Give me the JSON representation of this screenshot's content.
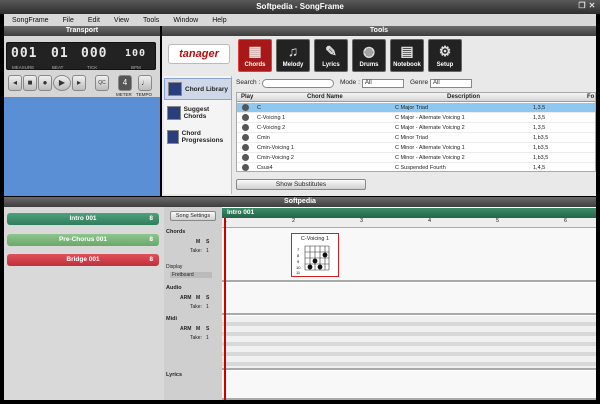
{
  "window": {
    "title": "Softpedia - SongFrame"
  },
  "menu": [
    "SongFrame",
    "File",
    "Edit",
    "View",
    "Tools",
    "Window",
    "Help"
  ],
  "transport": {
    "header": "Transport",
    "measure": "001",
    "beat": "01",
    "tick": "000",
    "bpm": "100",
    "labels": {
      "measure": "MEASURE",
      "beat": "BEAT",
      "tick": "TICK",
      "bpm": "BPM",
      "meter": "METER",
      "tempo": "TEMPO"
    },
    "meter_value": "4",
    "qc": "QC"
  },
  "tools": {
    "header": "Tools",
    "logo": "tanager",
    "buttons": [
      {
        "label": "Chords",
        "icon": "chord-grid-icon",
        "selected": true
      },
      {
        "label": "Melody",
        "icon": "melody-icon",
        "selected": false
      },
      {
        "label": "Lyrics",
        "icon": "lyrics-icon",
        "selected": false
      },
      {
        "label": "Drums",
        "icon": "drums-icon",
        "selected": false
      },
      {
        "label": "Notebook",
        "icon": "notebook-icon",
        "selected": false
      },
      {
        "label": "Setup",
        "icon": "setup-icon",
        "selected": false
      }
    ],
    "nav": [
      {
        "label": "Chord Library",
        "selected": true
      },
      {
        "label": "Suggest Chords",
        "selected": false
      },
      {
        "label": "Chord Progressions",
        "selected": false
      }
    ],
    "search_label": "Search :",
    "mode_label": "Mode :",
    "mode_value": "All",
    "genre_label": "Genre :",
    "genre_value": "All",
    "columns": [
      "Play",
      "Chord Name",
      "Description",
      "Fo"
    ],
    "rows": [
      {
        "name": "C",
        "desc": "C Major Triad",
        "formula": "1,3,5"
      },
      {
        "name": "C-Voicing 1",
        "desc": "C Major - Alternate Voicing 1",
        "formula": "1,3,5"
      },
      {
        "name": "C-Voicing 2",
        "desc": "C Major - Alternate Voicing 2",
        "formula": "1,3,5"
      },
      {
        "name": "Cmin",
        "desc": "C Minor Triad",
        "formula": "1,b3,5"
      },
      {
        "name": "Cmin-Voicing 1",
        "desc": "C Minor - Alternate Voicing 1",
        "formula": "1,b3,5"
      },
      {
        "name": "Cmin-Voicing 2",
        "desc": "C Minor - Alternate Voicing 2",
        "formula": "1,b3,5"
      },
      {
        "name": "Csus4",
        "desc": "C Suspended Fourth",
        "formula": "1,4,5"
      }
    ],
    "show_substitutes": "Show Substitutes"
  },
  "softpedia_header": "Softpedia",
  "sections": [
    {
      "label": "Intro 001",
      "count": "8",
      "color": "#2f7d5c"
    },
    {
      "label": "Pre-Chorus 001",
      "count": "8",
      "color": "#6aa86a"
    },
    {
      "label": "Bridge 001",
      "count": "8",
      "color": "#c0303a"
    }
  ],
  "song_settings": "Song Settings",
  "track_labels": {
    "m": "M",
    "s": "S",
    "arm": "ARM",
    "take": "Take:",
    "take_value": "1",
    "display": "Display",
    "display_value": "Fretboard"
  },
  "tracks": [
    "Chords",
    "Audio",
    "Midi",
    "Lyrics"
  ],
  "timeline": {
    "section_name": "Intro 001",
    "ruler": [
      "1",
      "2",
      "3",
      "4",
      "5",
      "6",
      "7"
    ],
    "chord_card": {
      "name": "C-Voicing 1",
      "frets": [
        "7",
        "8",
        "9",
        "10",
        "11"
      ]
    }
  }
}
